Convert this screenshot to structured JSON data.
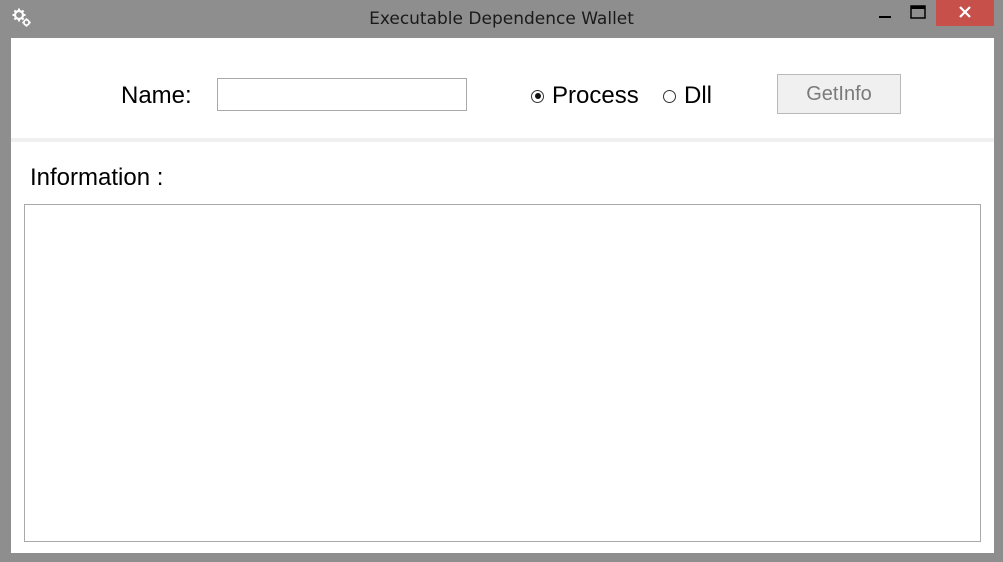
{
  "window": {
    "title": "Executable Dependence Wallet"
  },
  "form": {
    "name_label": "Name:",
    "name_value": "",
    "mode": {
      "options": [
        "Process",
        "Dll"
      ],
      "selected": "Process"
    },
    "getinfo_label": "GetInfo",
    "getinfo_enabled": false
  },
  "information": {
    "label": "Information :",
    "content": ""
  },
  "icons": {
    "app": "gears-icon",
    "minimize": "minimize-icon",
    "maximize": "maximize-icon",
    "close": "close-icon"
  },
  "colors": {
    "titlebar": "#8e8e8e",
    "close_button": "#c7504b",
    "client_background": "#ffffff"
  }
}
